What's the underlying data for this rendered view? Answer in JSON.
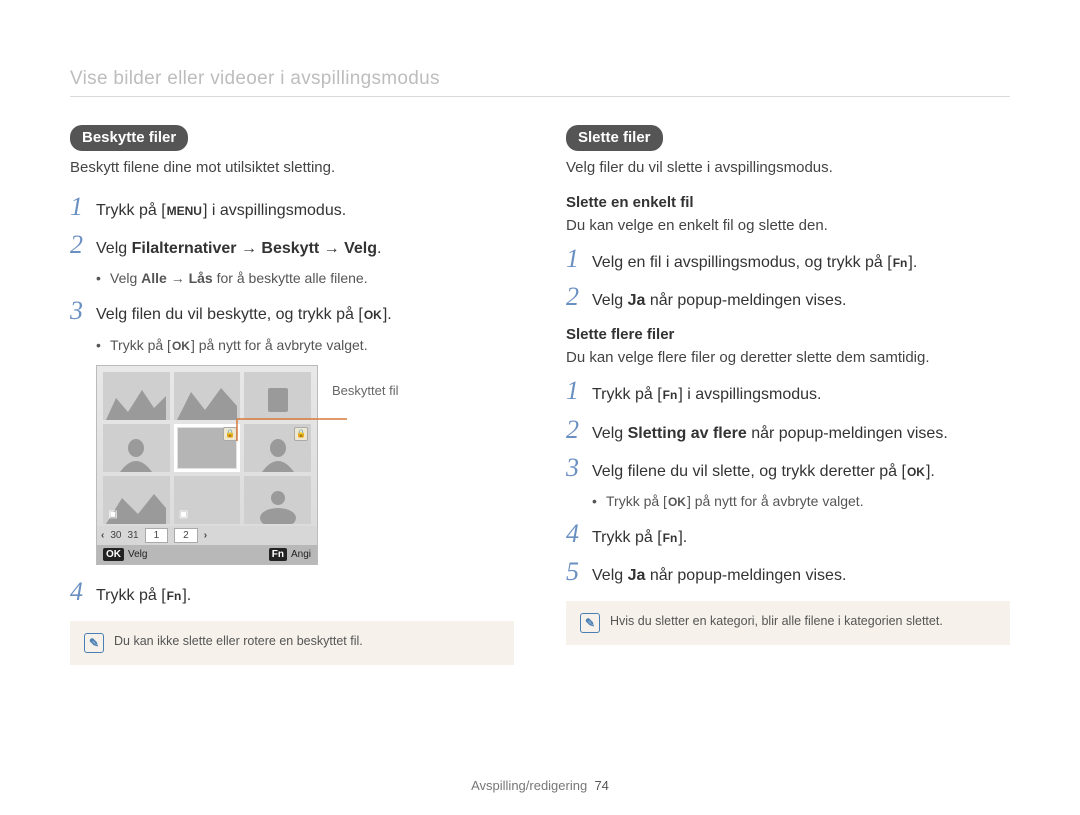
{
  "page_title": "Vise bilder eller videoer i avspillingsmodus",
  "footer_section": "Avspilling/redigering",
  "footer_page": "74",
  "left": {
    "pill": "Beskytte filer",
    "lead": "Beskytt filene dine mot utilsiktet sletting.",
    "steps": {
      "s1_a": "Trykk på [",
      "s1_icon": "MENU",
      "s1_b": "] i avspillingsmodus.",
      "s2_a": "Velg ",
      "s2_b": "Filalternativer → Beskytt → Velg",
      "s2_c": ".",
      "s2_sub_a": "Velg ",
      "s2_sub_b": "Alle → Lås",
      "s2_sub_c": " for å beskytte alle filene.",
      "s3_a": "Velg filen du vil beskytte, og trykk på [",
      "s3_icon": "OK",
      "s3_b": "].",
      "s3_sub_a": "Trykk på [",
      "s3_sub_icon": "OK",
      "s3_sub_b": "] på nytt for å avbryte valget.",
      "s4_a": "Trykk på [",
      "s4_icon": "Fn",
      "s4_b": "]."
    },
    "callout": "Beskyttet fil",
    "note": "Du kan ikke slette eller rotere en beskyttet fil.",
    "screenshot": {
      "dates": [
        "30",
        "31"
      ],
      "pages": [
        "1",
        "2"
      ],
      "ok_label": "Velg",
      "fn_label": "Angi",
      "ok_btn": "OK",
      "fn_btn": "Fn"
    }
  },
  "right": {
    "pill": "Slette filer",
    "lead": "Velg filer du vil slette i avspillingsmodus.",
    "sub1": "Slette en enkelt fil",
    "sub1_lead": "Du kan velge en enkelt fil og slette den.",
    "a": {
      "s1_a": "Velg en fil i avspillingsmodus, og trykk på [",
      "s1_icon": "Fn",
      "s1_b": "].",
      "s2_a": "Velg ",
      "s2_b": "Ja",
      "s2_c": " når popup-meldingen vises."
    },
    "sub2": "Slette flere filer",
    "sub2_lead": "Du kan velge flere filer og deretter slette dem samtidig.",
    "b": {
      "s1_a": "Trykk på [",
      "s1_icon": "Fn",
      "s1_b": "] i avspillingsmodus.",
      "s2_a": "Velg ",
      "s2_b": "Sletting av flere",
      "s2_c": " når popup-meldingen vises.",
      "s3_a": "Velg filene du vil slette, og trykk deretter på [",
      "s3_icon": "OK",
      "s3_b": "].",
      "s3_sub_a": "Trykk på [",
      "s3_sub_icon": "OK",
      "s3_sub_b": "] på nytt for å avbryte valget.",
      "s4_a": "Trykk på [",
      "s4_icon": "Fn",
      "s4_b": "].",
      "s5_a": "Velg ",
      "s5_b": "Ja",
      "s5_c": " når popup-meldingen vises."
    },
    "note": "Hvis du sletter en kategori, blir alle filene i kategorien slettet."
  }
}
